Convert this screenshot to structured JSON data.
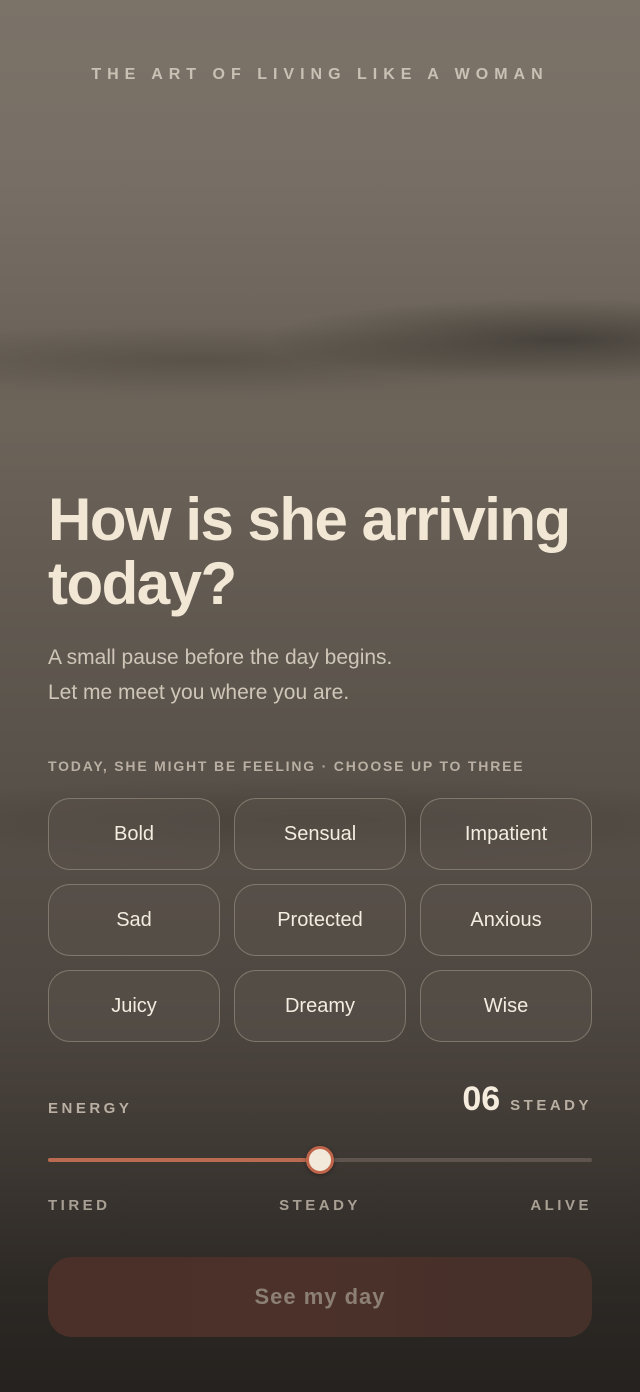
{
  "brand": {
    "title": "THE ART OF LIVING LIKE A WOMAN"
  },
  "hero": {
    "headline": "How is she arriving today?",
    "subtitle_lines": [
      "A small pause before the day begins.",
      "Let me meet you where you are."
    ]
  },
  "feelings": {
    "label": "TODAY, SHE MIGHT BE FEELING · CHOOSE UP TO THREE",
    "max_selections": 3,
    "options": [
      "Bold",
      "Sensual",
      "Impatient",
      "Sad",
      "Protected",
      "Anxious",
      "Juicy",
      "Dreamy",
      "Wise"
    ],
    "selected": []
  },
  "energy": {
    "label": "ENERGY",
    "value": "06",
    "value_word": "STEADY",
    "level_fraction": 0.5,
    "scale_min": "TIRED",
    "scale_mid": "STEADY",
    "scale_max": "ALIVE"
  },
  "cta": {
    "label": "See my day",
    "enabled": false
  },
  "colors": {
    "accent": "#c0644a",
    "headline_text": "#f1e7d4",
    "cta_background": "#4a3028"
  }
}
